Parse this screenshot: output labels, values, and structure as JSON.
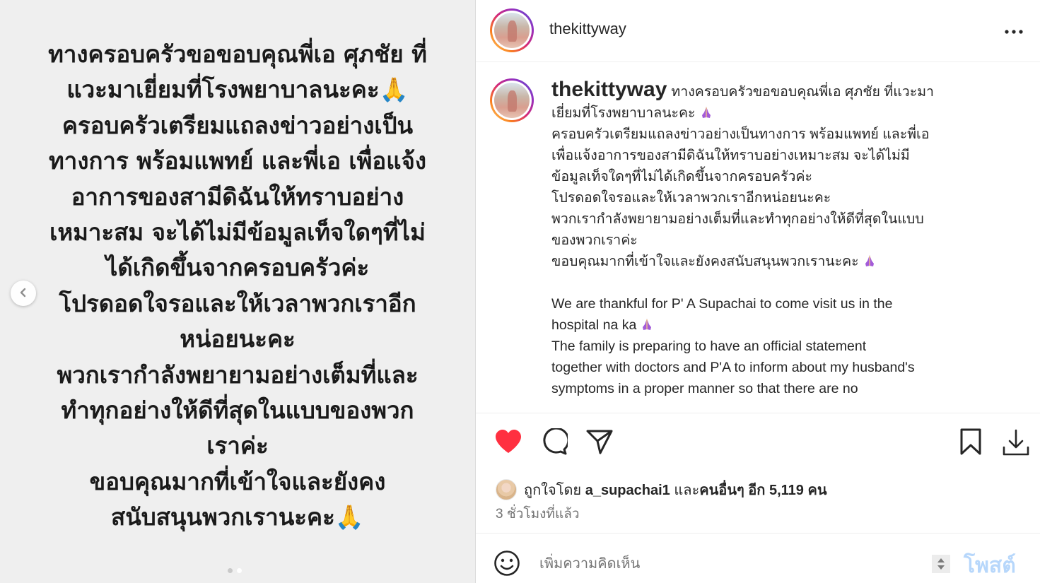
{
  "media": {
    "text_lines": [
      "ทางครอบครัวขอขอบคุณพี่เอ ศุภชัย ที่",
      "แวะมาเยี่ยมที่โรงพยาบาลนะคะ🙏",
      "ครอบครัวเตรียมแถลงข่าวอย่างเป็น",
      "ทางการ พร้อมแพทย์ และพี่เอ เพื่อแจ้ง",
      "อาการของสามีดิฉันให้ทราบอย่าง",
      "เหมาะสม จะได้ไม่มีข้อมูลเท็จใดๆที่ไม่",
      "ได้เกิดขึ้นจากครอบครัวค่ะ",
      "โปรดอดใจรอและให้เวลาพวกเราอีก",
      "หน่อยนะคะ",
      "พวกเรากำลังพยายามอย่างเต็มที่และ",
      "ทำทุกอย่างให้ดีที่สุดในแบบของพวก",
      "เราค่ะ",
      "ขอบคุณมากที่เข้าใจและยังคง",
      "สนับสนุนพวกเรานะคะ🙏"
    ],
    "carousel_total": 2,
    "carousel_current": 2
  },
  "header": {
    "username": "thekittyway"
  },
  "caption": {
    "username": "thekittyway",
    "lines": [
      "ทางครอบครัวขอขอบคุณพี่เอ ศุภชัย ที่แวะมา",
      "เยี่ยมที่โรงพยาบาลนะคะ",
      "ครอบครัวเตรียมแถลงข่าวอย่างเป็นทางการ พร้อมแพทย์ และพี่เอ",
      "เพื่อแจ้งอาการของสามีดิฉันให้ทราบอย่างเหมาะสม จะได้ไม่มี",
      "ข้อมูลเท็จใดๆที่ไม่ได้เกิดขึ้นจากครอบครัวค่ะ",
      "โปรดอดใจรอและให้เวลาพวกเราอีกหน่อยนะคะ",
      "พวกเรากำลังพยายามอย่างเต็มที่และทำทุกอย่างให้ดีที่สุดในแบบ",
      "ของพวกเราค่ะ",
      "ขอบคุณมากที่เข้าใจและยังคงสนับสนุนพวกเรานะคะ",
      "We are thankful for P' A Supachai to come visit us in the",
      "hospital na ka",
      "The family is preparing to have an official statement",
      "together with doctors and P'A to inform about my husband's",
      "symptoms in a proper manner so that there are no"
    ]
  },
  "likes": {
    "prefix": "ถูกใจโดย ",
    "liker": "a_supachai1",
    "middle": " และ",
    "others": "คนอื่นๆ อีก 5,119 คน"
  },
  "time": "3 ชั่วโมงที่แล้ว",
  "comment": {
    "placeholder": "เพิ่มความคิดเห็น",
    "post_label": "โพสต์"
  },
  "colors": {
    "like_red": "#ff3040",
    "post_blue_disabled": "#b7d7fb",
    "emoji_purple": "#a35bd9"
  },
  "icons": [
    "chevron-left-icon",
    "more-icon",
    "heart-icon",
    "comment-icon",
    "share-icon",
    "bookmark-icon",
    "download-icon",
    "emoji-icon",
    "pray-icon"
  ]
}
